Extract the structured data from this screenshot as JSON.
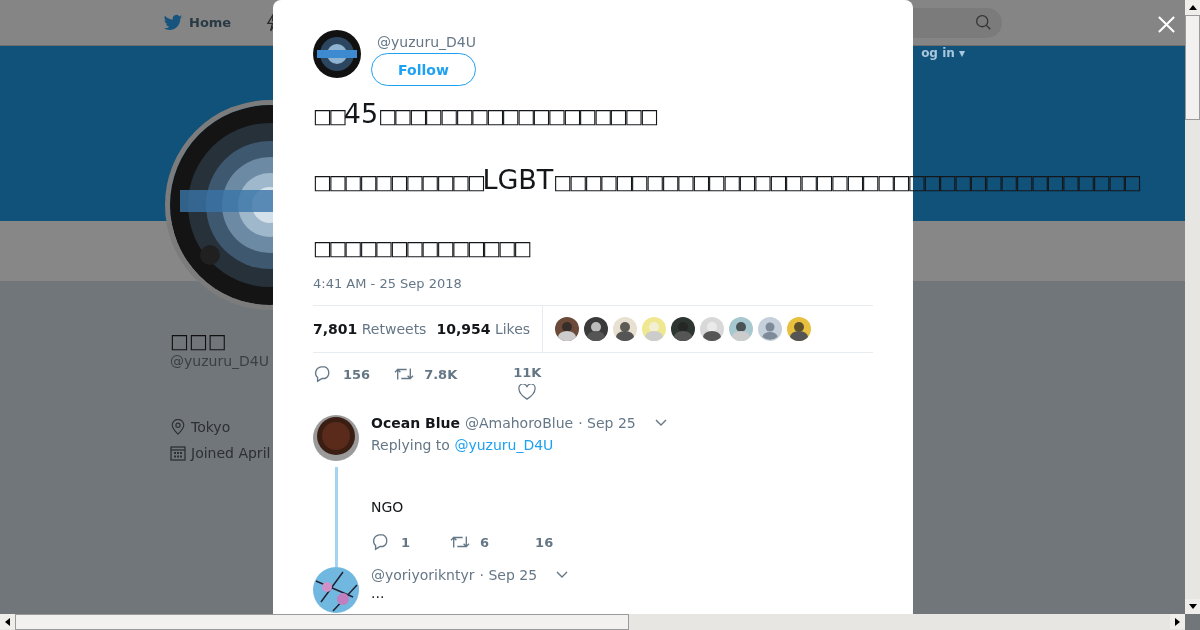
{
  "nav": {
    "home": "Home",
    "login": "og in ▾"
  },
  "profile": {
    "name": "□□□",
    "handle": "@yuzuru_D4U",
    "location": "Tokyo",
    "joined": "Joined April"
  },
  "tweet": {
    "handle": "@yuzuru_D4U",
    "follow": "Follow",
    "lines": [
      "□□45□□□□□□□□□□□□□□□□□□",
      "□□□□□□□□□□□LGBT□□□□□□□□□□□□□□□□□□□□□□□□□□□□□□□□□□□□□□",
      "□□□□□□□□□□□□□□"
    ],
    "timestamp": "4:41 AM - 25 Sep 2018",
    "retweets_count": "7,801",
    "retweets_label": "Retweets",
    "likes_count": "10,954",
    "likes_label": "Likes",
    "likers": [
      {
        "kind": "picture"
      },
      {
        "kind": "picture"
      },
      {
        "kind": "picture"
      },
      {
        "kind": "picture"
      },
      {
        "kind": "picture"
      },
      {
        "kind": "picture"
      },
      {
        "kind": "picture"
      },
      {
        "kind": "default"
      },
      {
        "kind": "picture"
      }
    ],
    "replies": "156",
    "retweets": "7.8K",
    "likes": "11K"
  },
  "replies": [
    {
      "name": "Ocean Blue",
      "handle": "@AmahoroBlue",
      "date": "· Sep 25",
      "replying": "Replying to",
      "mention": "@yuzuru_D4U",
      "text": "NGO",
      "replies": "1",
      "retweets": "6",
      "likes": "16",
      "thread": true
    },
    {
      "handle": "@yoriyorikntyr",
      "date": "· Sep 25",
      "text": "...",
      "thread": false
    }
  ]
}
